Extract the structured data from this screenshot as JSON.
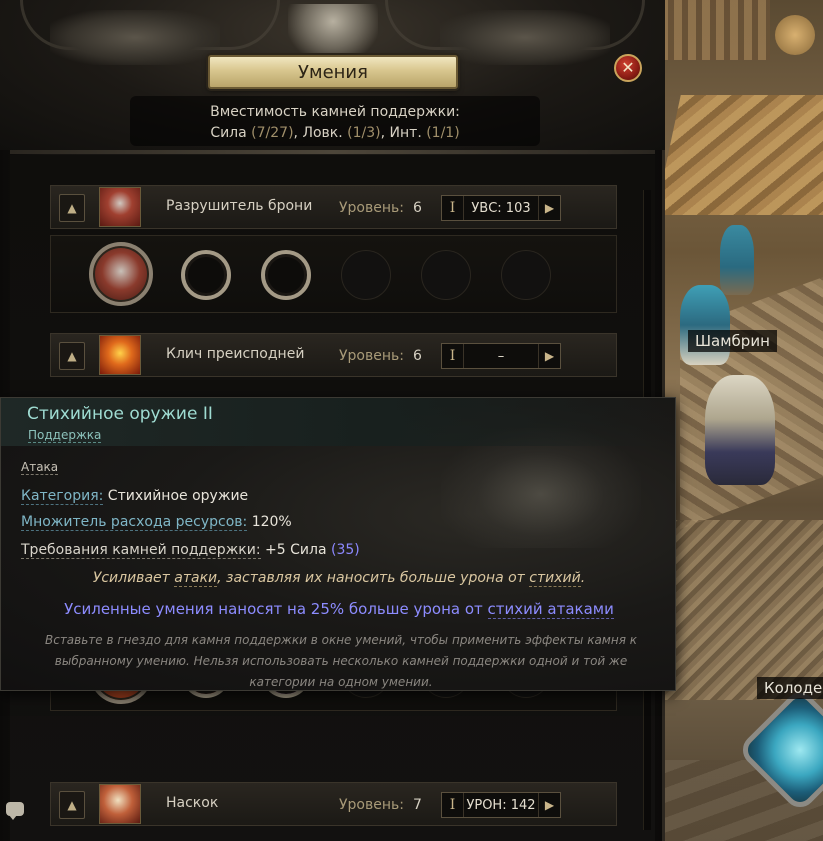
{
  "panel": {
    "title": "Умения",
    "close_glyph": "✕",
    "capacity": {
      "heading": "Вместимость камней поддержки:",
      "str_label": "Сила",
      "str_value": "(7/27)",
      "dex_label": "Ловк.",
      "dex_value": "(1/3)",
      "int_label": "Инт.",
      "int_value": "(1/1)"
    }
  },
  "skills": [
    {
      "name": "Разрушитель брони",
      "level_label": "Уровень:",
      "level": "6",
      "stat_bar": "I",
      "stat": "УВС: 103",
      "arrow": "▶",
      "icon": "hammer-icon",
      "up": "▲"
    },
    {
      "name": "Клич преисподней",
      "level_label": "Уровень:",
      "level": "6",
      "stat_bar": "I",
      "stat": "–",
      "arrow": "▶",
      "icon": "infernal-cry-icon",
      "up": "▲"
    },
    {
      "name": "Наскок",
      "level_label": "Уровень:",
      "level": "7",
      "stat_bar": "I",
      "stat": "УРОН: 142",
      "arrow": "▶",
      "icon": "leap-slam-icon",
      "up": "▲"
    }
  ],
  "tooltip": {
    "title": "Стихийное оружие II",
    "subtitle": "Поддержка",
    "tag": "Атака",
    "category_label": "Категория:",
    "category_value": "Стихийное оружие",
    "cost_label": "Множитель расхода ресурсов:",
    "cost_value": "120%",
    "req_label": "Требования камней поддержки:",
    "req_value": "+5 Сила",
    "req_extra": "(35)",
    "flavor_a": "Усиливает",
    "flavor_b": "атаки",
    "flavor_c": ", заставляя их наносить больше урона от",
    "flavor_d": "стихий",
    "flavor_e": ".",
    "mod_a": "Усиленные умения наносят на 25% больше урона от",
    "mod_b": "стихий атаками",
    "help": "Вставьте в гнездо для камня поддержки в окне умений, чтобы применить эффекты камня к выбранному умению. Нельзя использовать несколько камней поддержки одной и той же категории на одном умении."
  },
  "world": {
    "npc_label": "Шамбрин",
    "well_label": "Колоде"
  },
  "colors": {
    "accent_gold": "#d8c68e",
    "tooltip_title": "#9fdcd2",
    "modifier_blue": "#8d8cff",
    "close_red": "#8a1c14"
  }
}
